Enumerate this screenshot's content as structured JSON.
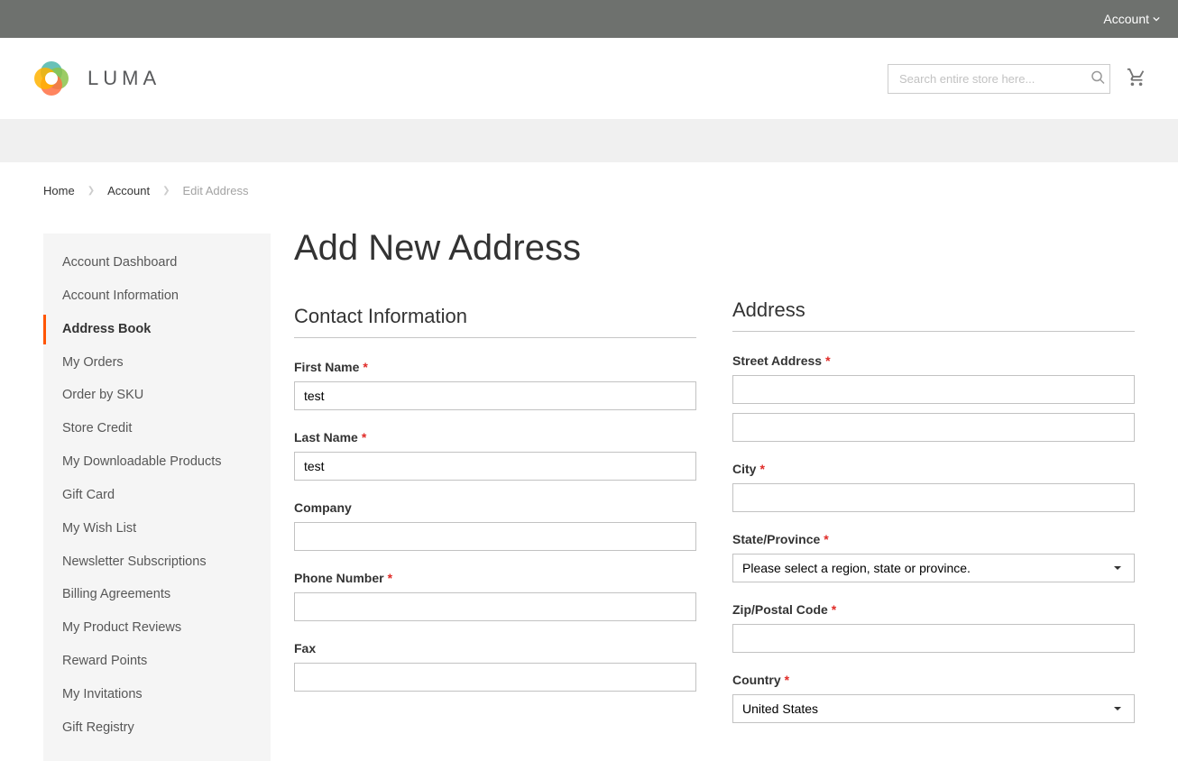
{
  "topbar": {
    "account_label": "Account"
  },
  "logo": {
    "text": "LUMA"
  },
  "search": {
    "placeholder": "Search entire store here..."
  },
  "breadcrumbs": {
    "home": "Home",
    "account": "Account",
    "current": "Edit Address"
  },
  "sidebar": {
    "items": [
      {
        "label": "Account Dashboard",
        "active": false
      },
      {
        "label": "Account Information",
        "active": false
      },
      {
        "label": "Address Book",
        "active": true
      },
      {
        "label": "My Orders",
        "active": false
      },
      {
        "label": "Order by SKU",
        "active": false
      },
      {
        "label": "Store Credit",
        "active": false
      },
      {
        "label": "My Downloadable Products",
        "active": false
      },
      {
        "label": "Gift Card",
        "active": false
      },
      {
        "label": "My Wish List",
        "active": false
      },
      {
        "label": "Newsletter Subscriptions",
        "active": false
      },
      {
        "label": "Billing Agreements",
        "active": false
      },
      {
        "label": "My Product Reviews",
        "active": false
      },
      {
        "label": "Reward Points",
        "active": false
      },
      {
        "label": "My Invitations",
        "active": false
      },
      {
        "label": "Gift Registry",
        "active": false
      }
    ]
  },
  "page": {
    "title": "Add New Address"
  },
  "contact": {
    "section_title": "Contact Information",
    "first_name_label": "First Name",
    "first_name_value": "test",
    "last_name_label": "Last Name",
    "last_name_value": "test",
    "company_label": "Company",
    "company_value": "",
    "phone_label": "Phone Number",
    "phone_value": "",
    "fax_label": "Fax",
    "fax_value": ""
  },
  "address": {
    "section_title": "Address",
    "street_label": "Street Address",
    "street1_value": "",
    "street2_value": "",
    "city_label": "City",
    "city_value": "",
    "state_label": "State/Province",
    "state_placeholder": "Please select a region, state or province.",
    "zip_label": "Zip/Postal Code",
    "zip_value": "",
    "country_label": "Country",
    "country_value": "United States"
  }
}
